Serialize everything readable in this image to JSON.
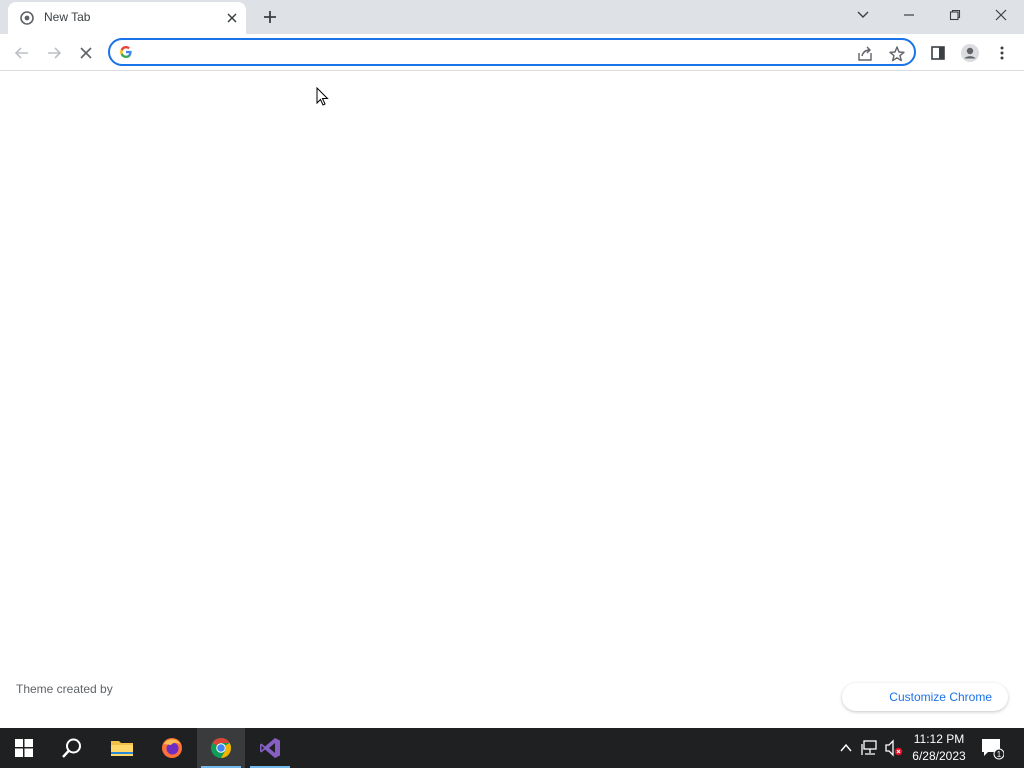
{
  "browser": {
    "tab": {
      "title": "New Tab"
    },
    "omnibox": {
      "value": "",
      "placeholder": ""
    }
  },
  "page": {
    "theme_credit": "Theme created by",
    "customize_label": "Customize Chrome"
  },
  "taskbar": {
    "apps": [
      "start-icon",
      "search-icon",
      "file-explorer-icon",
      "firefox-icon",
      "chrome-icon",
      "visual-studio-icon"
    ],
    "clock": {
      "time": "11:12 PM",
      "date": "6/28/2023"
    },
    "notification_count": "1"
  },
  "colors": {
    "accent": "#1a73e8",
    "tabstrip": "#dee1e6",
    "taskbar": "#1f2022"
  }
}
